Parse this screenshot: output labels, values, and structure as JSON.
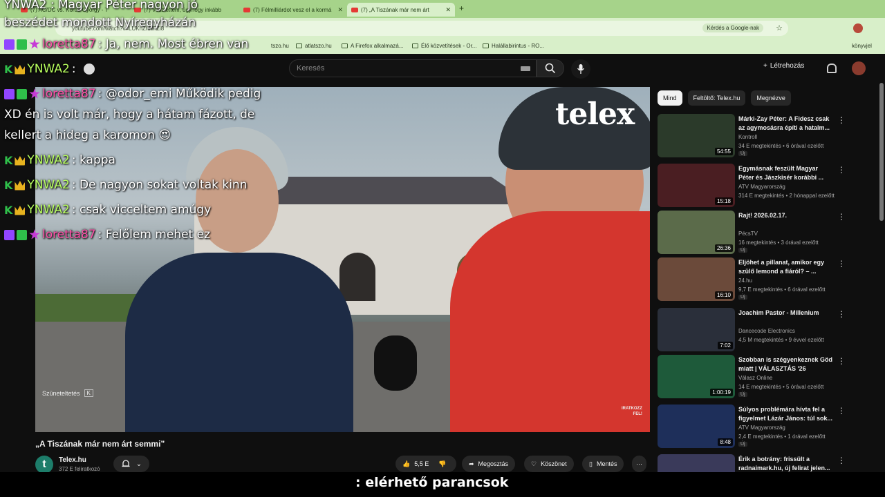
{
  "browser": {
    "tabs": [
      {
        "label": "(7) AC/DC vs. Korda György - T"
      },
      {
        "label": "(7) Vesztettem, úgyhogy inkább"
      },
      {
        "label": "(7) Félmilliárdot vesz el a kormá"
      },
      {
        "label": "(7) „A Tiszának már nem árt"
      }
    ],
    "url": "youtube.com/watch?v=LUKhZhNFZi8",
    "ask_google": "Kérdés a Google-nak",
    "bookmarks": [
      "atlatszo.hu",
      "A Firefox alkalmazá...",
      "Élő közvetítések - Or...",
      "Halállabirintus - RO..."
    ],
    "bookmarks_right": "könyvjel",
    "bookmark_partial": "tszo.hu"
  },
  "youtube": {
    "search_placeholder": "Keresés",
    "create_label": "Létrehozás"
  },
  "video": {
    "watermark": "telex",
    "corner_text": "IRATKOZZ\nFEL!",
    "pause_hint": "Szüneteltetés",
    "pause_key": "K",
    "title": "„A Tiszának már nem árt semmi”"
  },
  "channel": {
    "avatar_letter": "t",
    "name": "Telex.hu",
    "subs": "372 E feliratkozó"
  },
  "actions": {
    "likes": "5,5 E",
    "share": "Megosztás",
    "thanks": "Köszönet",
    "save": "Mentés"
  },
  "overlay": {
    "title_line1": "YNWA2 : Magyar Péter nagyon jó",
    "title_line2": "beszédet mondott Nyíregyházán",
    "subtitle": ": elérhető parancsok"
  },
  "chat": [
    {
      "user": "loretta87",
      "text": ": Ja, nem. Most ébren van",
      "kind": "lor"
    },
    {
      "user": "YNWA2",
      "text": " :",
      "kind": "ynwa"
    },
    {
      "user": "loretta87",
      "text": ": @odor_emi Működik pedig",
      "kind": "lor"
    },
    {
      "line": "XD én is volt már, hogy a hátam fázott, de"
    },
    {
      "line": "kellert a hideg a karomon 😍"
    },
    {
      "user": "YNWA2",
      "text": ": kappa",
      "kind": "ynwa"
    },
    {
      "user": "YNWA2",
      "text": ": De nagyon sokat voltak kinn",
      "kind": "ynwa"
    },
    {
      "user": "YNWA2",
      "text": ": csak vicceltem amúgy",
      "kind": "ynwa"
    },
    {
      "user": "loretta87",
      "text": ": Felőlem mehet ez",
      "kind": "lor"
    }
  ],
  "filters": [
    "Mind",
    "Feltöltő: Telex.hu",
    "Megnézve"
  ],
  "recommendations": [
    {
      "title": "Márki-Zay Péter: A Fidesz csak az agymosásra építi a hatalm...",
      "channel": "Kontroll",
      "meta": "34 E megtekintés • 6 órával ezelőtt",
      "duration": "54:55",
      "new": "Új",
      "color": "#2b3a2a"
    },
    {
      "title": "Egymásnak feszült Magyar Péter és Jászkisér korábbi ...",
      "channel": "ATV Magyarország",
      "meta": "314 E megtekintés • 2 hónappal ezelőtt",
      "duration": "15:18",
      "new": "",
      "color": "#4a1e22"
    },
    {
      "title": "Rajt! 2026.02.17.",
      "channel": "PécsTV",
      "meta": "16 megtekintés • 3 órával ezelőtt",
      "duration": "26:36",
      "new": "Új",
      "color": "#5b6b4a"
    },
    {
      "title": "Eljöhet a pillanat, amikor egy szülő lemond a fiáról? – ...",
      "channel": "24.hu",
      "meta": "9,7 E megtekintés • 6 órával ezelőtt",
      "duration": "16:10",
      "new": "Új",
      "color": "#6b4a3a"
    },
    {
      "title": "Joachim Pastor - Millenium",
      "channel": "Dancecode Electronics",
      "meta": "4,5 M megtekintés • 9 évvel ezelőtt",
      "duration": "7:02",
      "new": "",
      "color": "#2a2f3a"
    },
    {
      "title": "Szobban is szégyenkeznek Göd miatt | VÁLASZTÁS '26",
      "channel": "Válasz Online",
      "meta": "14 E megtekintés • 5 órával ezelőtt",
      "duration": "1:00:19",
      "new": "Új",
      "color": "#1e5a3a"
    },
    {
      "title": "Súlyos problémára hívta fel a figyelmet Lázár János: túl sok...",
      "channel": "ATV Magyarország",
      "meta": "2,4 E megtekintés • 1 órával ezelőtt",
      "duration": "8:48",
      "new": "Új",
      "color": "#1e2f5a"
    },
    {
      "title": "Érik a botrány: frissült a radnaimark.hu, új felirat jelen...",
      "channel": "",
      "meta": "",
      "duration": "",
      "new": "",
      "color": "#3a3a5a"
    }
  ]
}
